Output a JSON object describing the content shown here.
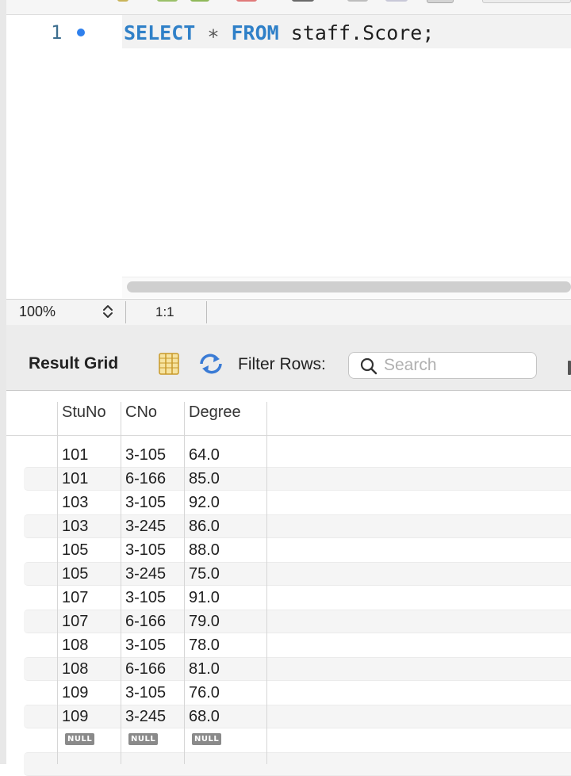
{
  "editor": {
    "line_number": "1",
    "code": {
      "keyword_select": "SELECT",
      "star": "∗",
      "keyword_from": "FROM",
      "rest": "staff.Score;"
    }
  },
  "status_bar": {
    "zoom": "100%",
    "cursor_position": "1:1"
  },
  "result_toolbar": {
    "title": "Result Grid",
    "filter_label": "Filter Rows:",
    "search_placeholder": "Search",
    "icons": [
      "grid-columns-icon",
      "refresh-icon",
      "search-icon"
    ]
  },
  "grid": {
    "columns": [
      "StuNo",
      "CNo",
      "Degree"
    ],
    "rows": [
      [
        "101",
        "3-105",
        "64.0"
      ],
      [
        "101",
        "6-166",
        "85.0"
      ],
      [
        "103",
        "3-105",
        "92.0"
      ],
      [
        "103",
        "3-245",
        "86.0"
      ],
      [
        "105",
        "3-105",
        "88.0"
      ],
      [
        "105",
        "3-245",
        "75.0"
      ],
      [
        "107",
        "3-105",
        "91.0"
      ],
      [
        "107",
        "6-166",
        "79.0"
      ],
      [
        "108",
        "3-105",
        "78.0"
      ],
      [
        "108",
        "6-166",
        "81.0"
      ],
      [
        "109",
        "3-105",
        "76.0"
      ],
      [
        "109",
        "3-245",
        "68.0"
      ]
    ],
    "null_label": "NULL"
  },
  "colors": {
    "keyword": "#2f80c8",
    "line_number": "#3d6e8f",
    "breakpoint": "#2f80ed"
  }
}
